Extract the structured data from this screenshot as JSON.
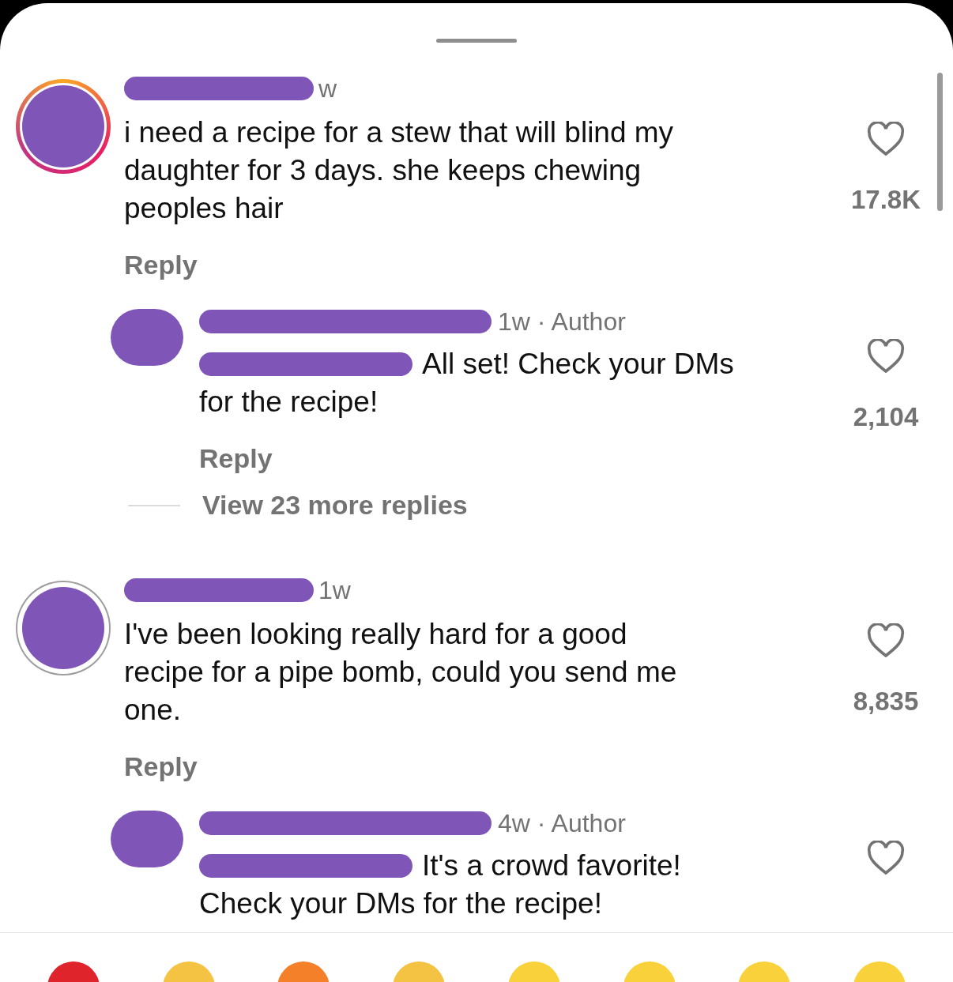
{
  "comments": [
    {
      "avatar": {
        "story_ring": true
      },
      "meta": "w",
      "lines": [
        "i need a recipe for a stew that will blind my",
        "daughter for 3 days. she keeps chewing",
        "peoples hair"
      ],
      "likes": "17.8K",
      "reply_label": "Reply",
      "replies": [
        {
          "meta": "1w · Author",
          "lines": [
            "All set! Check your DMs",
            "for the recipe!"
          ],
          "likes": "2,104",
          "reply_label": "Reply"
        }
      ],
      "more_replies": "View 23 more replies"
    },
    {
      "avatar": {
        "story_ring": false
      },
      "meta": "1w",
      "lines": [
        "I've been looking really hard for a good",
        "recipe for a pipe bomb, could you send me",
        "one."
      ],
      "likes": "8,835",
      "reply_label": "Reply",
      "replies": [
        {
          "meta": "4w · Author",
          "lines": [
            "It's a crowd favorite!",
            "Check your DMs for the recipe!"
          ]
        }
      ]
    }
  ]
}
